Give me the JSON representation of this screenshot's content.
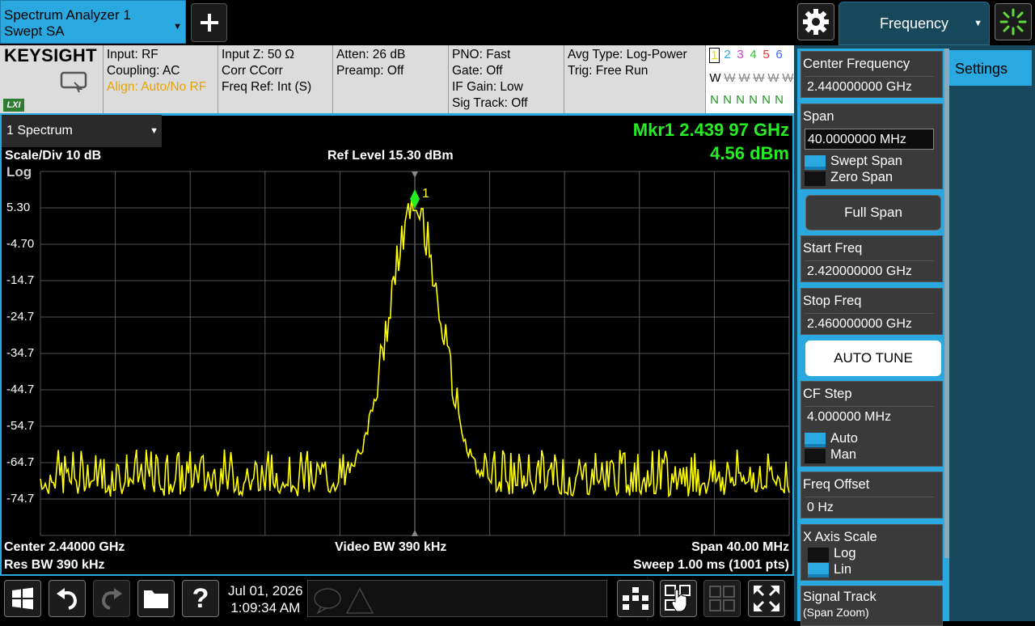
{
  "app_tab": {
    "line1": "Spectrum Analyzer 1",
    "line2": "Swept SA"
  },
  "mode_tab": {
    "label": "Frequency"
  },
  "settings_tab": {
    "label": "Settings"
  },
  "brand": {
    "logo": "KEYSIGHT",
    "lxi": "LXI"
  },
  "info": {
    "col1": [
      "Input: RF",
      "Coupling: AC",
      "Align: Auto/No RF"
    ],
    "col2": [
      "Input Z: 50 Ω",
      "Corr CCorr",
      "Freq Ref: Int (S)"
    ],
    "col3": [
      "Atten: 26 dB",
      "Preamp: Off"
    ],
    "col4": [
      "PNO: Fast",
      "Gate: Off",
      "IF Gain: Low",
      "Sig Track: Off"
    ],
    "col5": [
      "Avg Type: Log-Power",
      "Trig: Free Run"
    ]
  },
  "traces": {
    "numbers": [
      "1",
      "2",
      "3",
      "4",
      "5",
      "6"
    ],
    "colors": [
      "#e0e000",
      "#2aa8e0",
      "#d040d0",
      "#22cc22",
      "#ee3333",
      "#3a66ff"
    ],
    "types": [
      "W",
      "W",
      "W",
      "W",
      "W",
      "W"
    ],
    "detectors": [
      "N",
      "N",
      "N",
      "N",
      "N",
      "N"
    ]
  },
  "window": {
    "selector": "1 Spectrum"
  },
  "graph": {
    "marker_freq": "Mkr1  2.439 97 GHz",
    "marker_amp": "4.56 dBm",
    "marker_label": "1",
    "scale": "Scale/Div 10 dB",
    "ref_level": "Ref Level 15.30 dBm",
    "scale_type": "Log",
    "y_ticks": [
      "5.30",
      "-4.70",
      "-14.7",
      "-24.7",
      "-34.7",
      "-44.7",
      "-54.7",
      "-64.7",
      "-74.7"
    ],
    "center": "Center 2.44000 GHz",
    "video_bw": "Video BW 390 kHz",
    "span": "Span 40.00 MHz",
    "res_bw": "Res BW 390 kHz",
    "sweep": "Sweep 1.00 ms (1001 pts)"
  },
  "menu": {
    "center_freq": {
      "label": "Center Frequency",
      "value": "2.440000000 GHz"
    },
    "span": {
      "label": "Span",
      "value": "40.0000000 MHz"
    },
    "swept_span": "Swept Span",
    "zero_span": "Zero Span",
    "full_span": "Full Span",
    "start_freq": {
      "label": "Start Freq",
      "value": "2.420000000 GHz"
    },
    "stop_freq": {
      "label": "Stop Freq",
      "value": "2.460000000 GHz"
    },
    "auto_tune": "AUTO TUNE",
    "cf_step": {
      "label": "CF Step",
      "value": "4.000000 MHz"
    },
    "auto": "Auto",
    "man": "Man",
    "freq_offset": {
      "label": "Freq Offset",
      "value": "0 Hz"
    },
    "x_axis_scale": "X Axis Scale",
    "log": "Log",
    "lin": "Lin",
    "signal_track": "Signal Track",
    "signal_track_sub": "(Span Zoom)"
  },
  "status": {
    "date": "Jul 01, 2026",
    "time": "1:09:34 AM"
  },
  "colors": {
    "accent": "#2aa8e0",
    "trace": "#ffff00",
    "marker": "#22ee22",
    "panel": "#18485c"
  }
}
